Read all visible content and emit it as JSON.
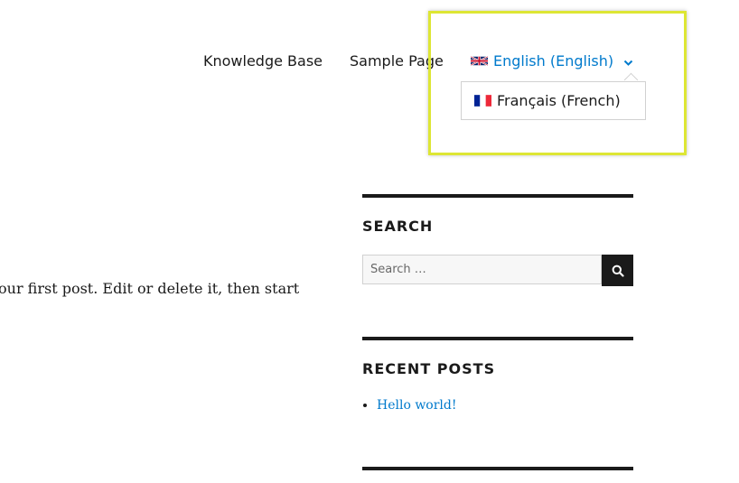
{
  "nav": {
    "items": [
      {
        "label": "Knowledge Base"
      },
      {
        "label": "Sample Page"
      }
    ],
    "language_switcher": {
      "current_label": "English (English)",
      "current_flag_icon": "uk-flag-icon",
      "toggle_icon": "chevron-down-icon",
      "options": [
        {
          "label": "Français (French)",
          "flag_icon": "french-flag-icon"
        }
      ]
    }
  },
  "post": {
    "excerpt": "our first post. Edit or delete it, then start"
  },
  "sidebar": {
    "search": {
      "title": "SEARCH",
      "placeholder": "Search …",
      "button_icon": "search-icon"
    },
    "recent_posts": {
      "title": "RECENT POSTS",
      "items": [
        {
          "label": "Hello world!"
        }
      ]
    }
  },
  "colors": {
    "link": "#007acc",
    "text": "#1a1a1a",
    "highlight": "#dde634",
    "rule": "#1a1a1a"
  }
}
